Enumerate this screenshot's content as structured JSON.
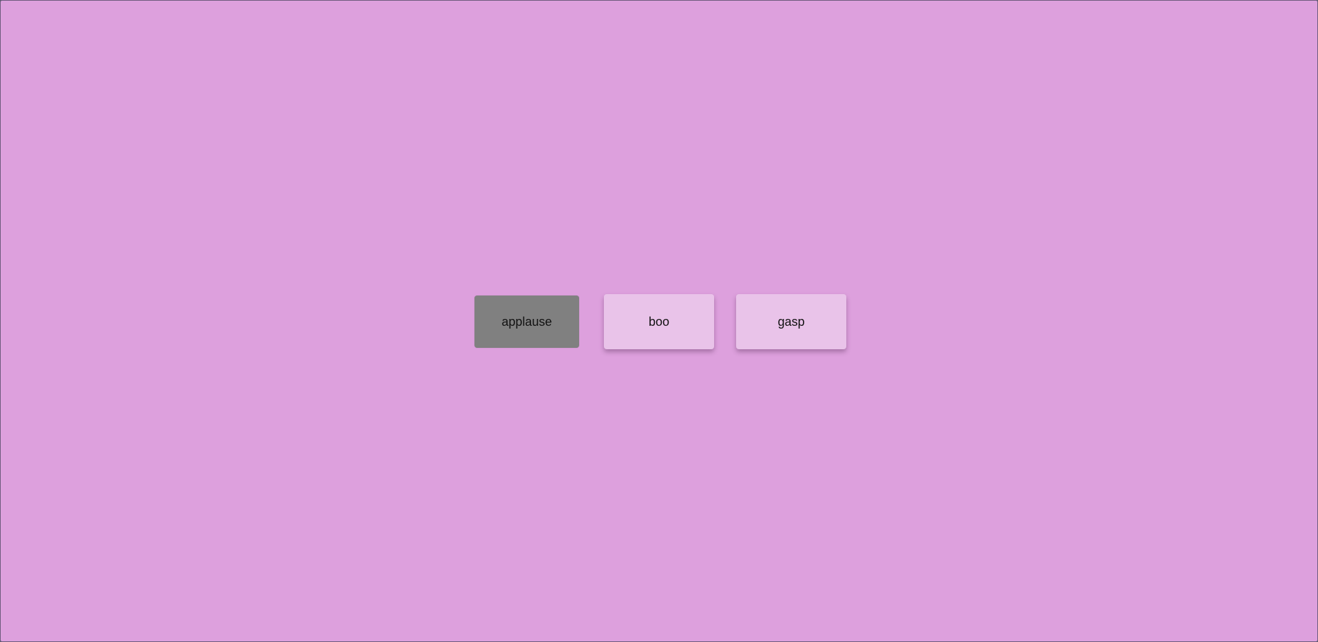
{
  "theme": {
    "background_color": "#dda0dd",
    "selected_button_color": "#808080",
    "button_color": "#e9c3e9"
  },
  "buttons": [
    {
      "label": "applause",
      "state": "selected"
    },
    {
      "label": "boo",
      "state": "default"
    },
    {
      "label": "gasp",
      "state": "default"
    }
  ]
}
